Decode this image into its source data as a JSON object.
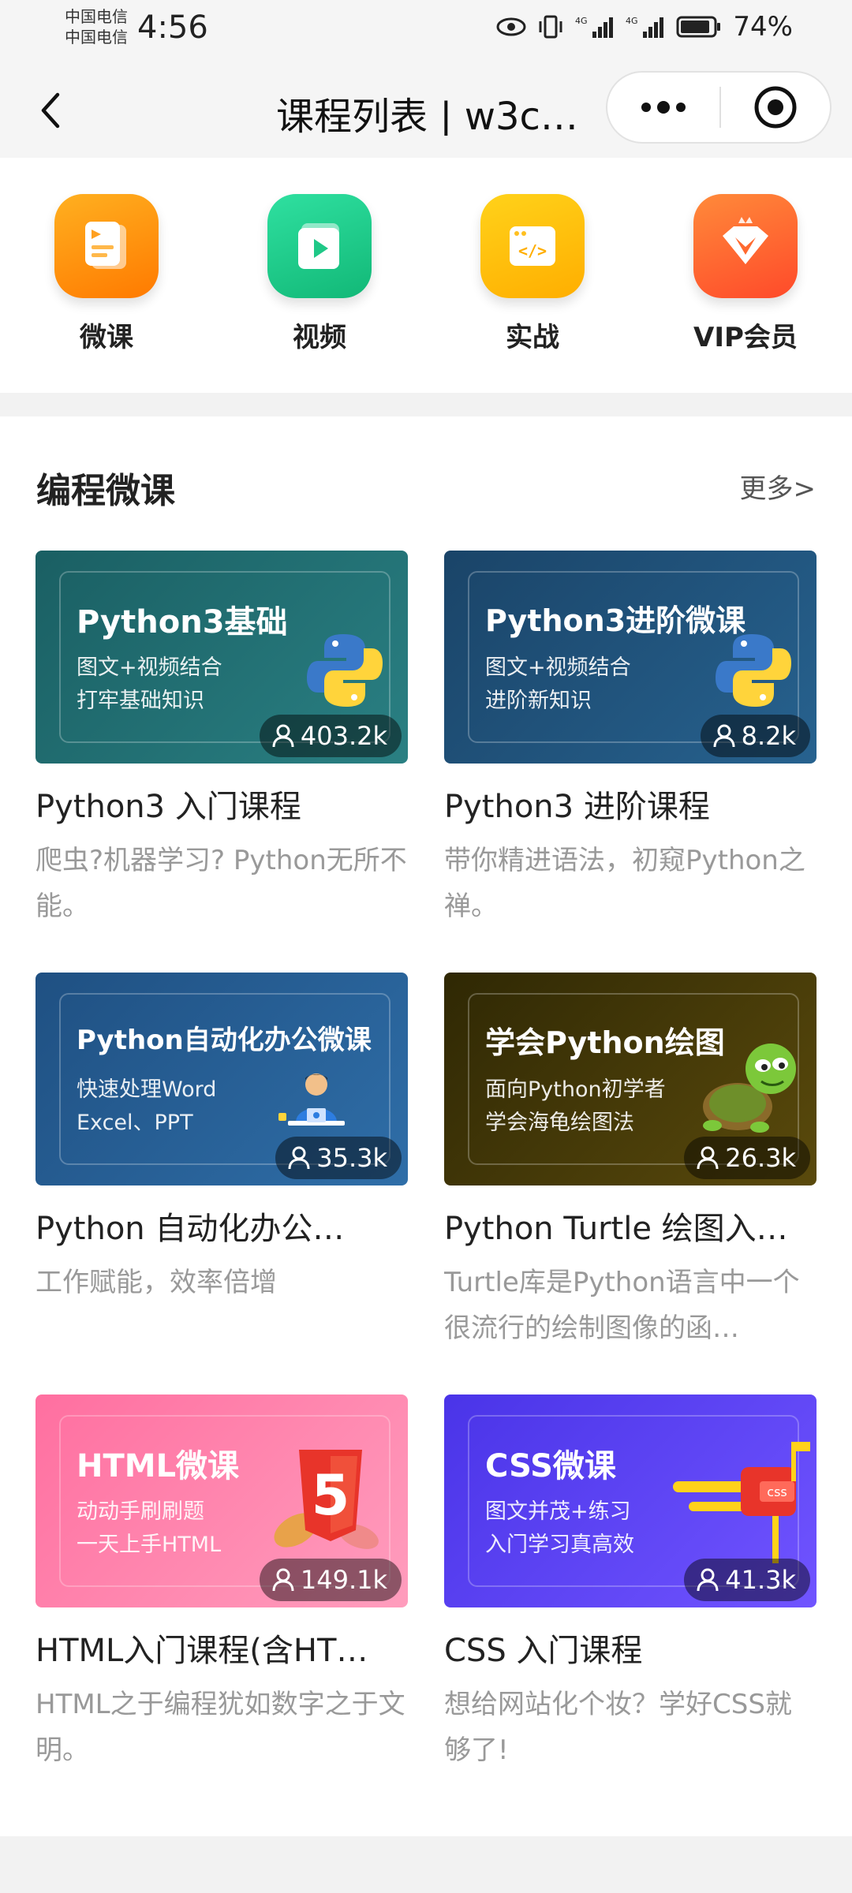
{
  "status_bar": {
    "carrier_1": "中国电信",
    "carrier_2": "中国电信",
    "time": "4:56",
    "battery": "74%"
  },
  "nav": {
    "title": "课程列表 | w3c…"
  },
  "quick_nav": [
    {
      "label": "微课",
      "icon": "document-icon",
      "color": "#ff8a00"
    },
    {
      "label": "视频",
      "icon": "video-play-icon",
      "color": "#1fcf8a"
    },
    {
      "label": "实战",
      "icon": "code-window-icon",
      "color": "#ffb800"
    },
    {
      "label": "VIP会员",
      "icon": "diamond-crown-icon",
      "color": "#ff5a2c"
    }
  ],
  "section": {
    "title": "编程微课",
    "more": "更多>"
  },
  "courses": [
    {
      "thumb_title": "Python3基础",
      "thumb_sub": "图文+视频结合\n打牢基础知识",
      "learners": "403.2k",
      "title": "Python3 入门课程",
      "desc": "爬虫?机器学习? Python无所不能。",
      "bg": "#1f6a6e"
    },
    {
      "thumb_title": "Python3进阶微课",
      "thumb_sub": "图文+视频结合\n进阶新知识",
      "learners": "8.2k",
      "title": "Python3 进阶课程",
      "desc": "带你精进语法，初窥Python之禅。",
      "bg": "#1f4c72"
    },
    {
      "thumb_title": "Python自动化办公微课",
      "thumb_sub": "快速处理Word\nExcel、PPT",
      "learners": "35.3k",
      "title": "Python 自动化办公…",
      "desc": "工作赋能，效率倍增",
      "bg": "#245d92"
    },
    {
      "thumb_title": "学会Python绘图",
      "thumb_sub": "面向Python初学者\n学会海龟绘图法",
      "learners": "26.3k",
      "title": "Python Turtle 绘图入…",
      "desc": "Turtle库是Python语言中一个很流行的绘制图像的函…",
      "bg": "#3c3406"
    },
    {
      "thumb_title": "HTML微课",
      "thumb_sub": "动动手刷刷题\n一天上手HTML",
      "learners": "149.1k",
      "title": "HTML入门课程(含HT…",
      "desc": "HTML之于编程犹如数字之于文明。",
      "bg": "#ff7fa8"
    },
    {
      "thumb_title": "CSS微课",
      "thumb_sub": "图文并茂+练习\n入门学习真高效",
      "learners": "41.3k",
      "title": "CSS 入门课程",
      "desc": "想给网站化个妆？学好CSS就够了!",
      "bg": "#5b40f0"
    }
  ]
}
